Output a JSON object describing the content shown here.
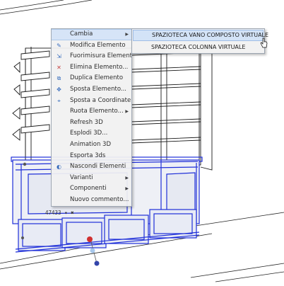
{
  "context_menu": {
    "items": [
      {
        "label": "Cambia",
        "icon": "none",
        "submenu": true,
        "highlighted": true
      },
      {
        "label": "Modifica Elemento",
        "icon": "edit-element-icon",
        "submenu": false
      },
      {
        "label": "Fuorimisura Elemento",
        "icon": "resize-element-icon",
        "submenu": false
      },
      {
        "label": "Elimina Elemento...",
        "icon": "delete-element-icon",
        "submenu": false
      },
      {
        "label": "Duplica Elemento",
        "icon": "duplicate-element-icon",
        "submenu": false
      },
      {
        "label": "Sposta Elemento...",
        "icon": "move-element-icon",
        "submenu": false
      },
      {
        "label": "Sposta a Coordinate...",
        "icon": "move-coordinates-icon",
        "submenu": false
      },
      {
        "label": "Ruota Elemento...",
        "icon": "none",
        "submenu": true
      },
      {
        "label": "Refresh 3D",
        "icon": "none",
        "submenu": false
      },
      {
        "label": "Esplodi 3D...",
        "icon": "none",
        "submenu": false
      },
      {
        "label": "Animation 3D",
        "icon": "none",
        "submenu": false
      },
      {
        "label": "Esporta 3ds",
        "icon": "none",
        "submenu": false
      },
      {
        "label": "Nascondi Elementi",
        "icon": "hide-elements-icon",
        "submenu": false
      },
      {
        "label": "Varianti",
        "icon": "none",
        "submenu": true
      },
      {
        "label": "Componenti",
        "icon": "none",
        "submenu": true
      },
      {
        "label": "Nuovo commento...",
        "icon": "none",
        "submenu": false
      }
    ]
  },
  "submenu": {
    "items": [
      {
        "label": "SPAZIOTECA VANO COMPOSTO VIRTUALE",
        "highlighted": true
      },
      {
        "label": "SPAZIOTECA COLONNA VIRTUALE",
        "highlighted": false
      }
    ]
  },
  "viewport": {
    "dimension_label": "47433",
    "selection_color": "#1f2fd8",
    "handle_colors": [
      "#d03030",
      "#a8c8ec",
      "#3344aa"
    ]
  }
}
